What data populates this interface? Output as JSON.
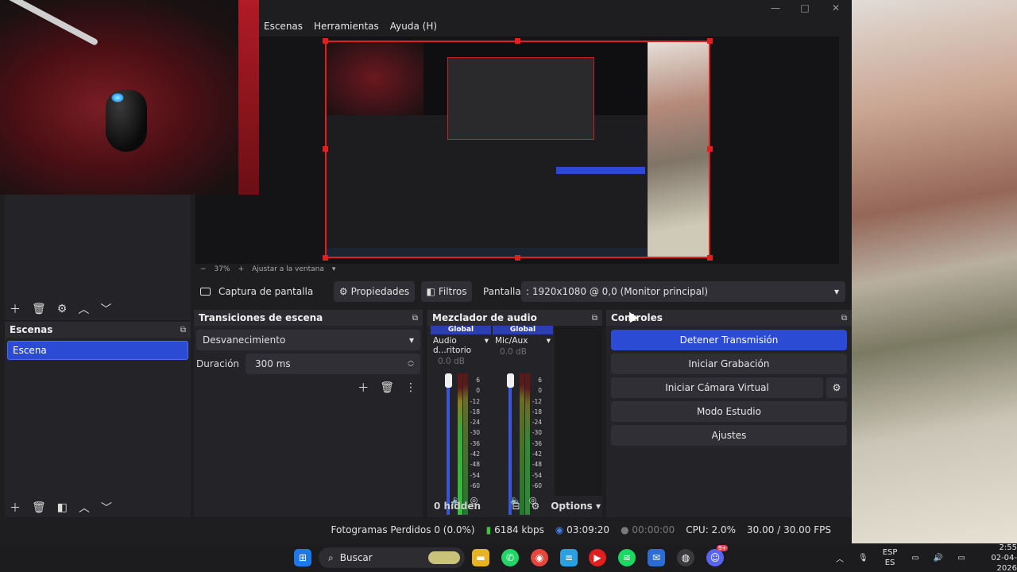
{
  "menu": {
    "scenes": "Escenas",
    "tools": "Herramientas",
    "help": "Ayuda (H)"
  },
  "window_controls": {
    "minimize": "—",
    "maximize": "□",
    "close": "✕"
  },
  "zoom": {
    "out": "−",
    "level": "37%",
    "in": "+",
    "fit": "Ajustar a la ventana"
  },
  "source_bar": {
    "source_name": "Captura de pantalla",
    "properties": "Propiedades",
    "filters": "Filtros",
    "screen_label": "Pantalla",
    "screen_value": ": 1920x1080 @ 0,0 (Monitor principal)"
  },
  "scenes": {
    "title": "Escenas",
    "items": [
      "Escena"
    ]
  },
  "transitions": {
    "title": "Transiciones de escena",
    "selected": "Desvanecimiento",
    "duration_label": "Duración",
    "duration_value": "300 ms"
  },
  "mixer": {
    "title": "Mezclador de audio",
    "channels": [
      {
        "header": "Global",
        "name": "Audio d...ritorio",
        "db": "0.0 dB",
        "level_fraction": 0.25
      },
      {
        "header": "Global",
        "name": "Mic/Aux",
        "db": "0.0 dB",
        "level_fraction": 0.1
      }
    ],
    "ticks": [
      "6",
      "0",
      "-12",
      "-18",
      "-24",
      "-30",
      "-36",
      "-42",
      "-48",
      "-54",
      "-60"
    ],
    "hidden": "0 hidden",
    "options": "Options"
  },
  "controls": {
    "title": "Controles",
    "stream": "Detener Transmisión",
    "record": "Iniciar Grabación",
    "virtualcam": "Iniciar Cámara Virtual",
    "studio": "Modo Estudio",
    "settings": "Ajustes"
  },
  "status": {
    "dropped": "Fotogramas Perdidos 0 (0.0%)",
    "bitrate": "6184 kbps",
    "stream_time": "03:09:20",
    "rec_time": "00:00:00",
    "cpu": "CPU: 2.0%",
    "fps": "30.00 / 30.00 FPS"
  },
  "taskbar": {
    "search": "Buscar",
    "lang_top": "ESP",
    "lang_bottom": "ES",
    "time": "2:55",
    "date": "02-04-2026",
    "discord_badge": "9+"
  },
  "colors": {
    "accent": "#2c4bd4",
    "selection": "#e02020",
    "panel": "#242428"
  }
}
